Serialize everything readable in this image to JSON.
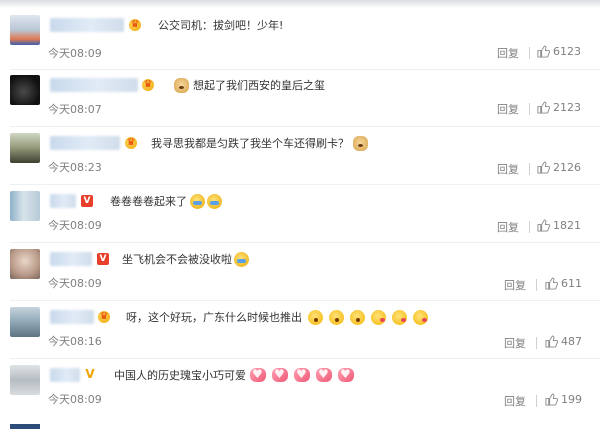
{
  "comments": [
    {
      "text": "公交司机：拔剑吧！少年!",
      "time": "今天08:09",
      "reply": "回复",
      "likes": "6123",
      "badge": "crown",
      "emojis_before": [],
      "emojis_after": []
    },
    {
      "text": "想起了我们西安的皇后之玺",
      "time": "今天08:07",
      "reply": "回复",
      "likes": "2123",
      "badge": "crown",
      "emojis_before": [
        "doge"
      ],
      "emojis_after": []
    },
    {
      "text": "我寻思我都是匀跌了我坐个车还得刷卡？",
      "time": "今天08:23",
      "reply": "回复",
      "likes": "2126",
      "badge": "crown",
      "emojis_before": [],
      "emojis_after": [
        "doge"
      ]
    },
    {
      "text": "卷卷卷卷起来了",
      "time": "今天08:09",
      "reply": "回复",
      "likes": "1821",
      "badge": "v-red",
      "emojis_before": [],
      "emojis_after": [
        "sob",
        "sob"
      ]
    },
    {
      "text": "坐飞机会不会被没收啦",
      "time": "今天08:09",
      "reply": "回复",
      "likes": "611",
      "badge": "v-red",
      "emojis_before": [],
      "emojis_after": [
        "sob"
      ]
    },
    {
      "text": "呀，这个好玩，广东什么时候也推出",
      "time": "今天08:16",
      "reply": "回复",
      "likes": "487",
      "badge": "crown",
      "emojis_before": [],
      "emojis_after": [
        "surprise",
        "surprise",
        "surprise",
        "kiss",
        "kiss",
        "kiss"
      ]
    },
    {
      "text": "中国人的历史瑰宝小巧可爱",
      "time": "今天08:09",
      "reply": "回复",
      "likes": "199",
      "badge": "v-gold",
      "emojis_before": [],
      "emojis_after": [
        "heart",
        "heart",
        "heart",
        "heart",
        "heart"
      ]
    }
  ],
  "colors": {
    "text": "#333333",
    "muted": "#808080",
    "crown": "#f0a400",
    "v_red": "#e83f2b",
    "name_blur": "#c8d9ec"
  }
}
